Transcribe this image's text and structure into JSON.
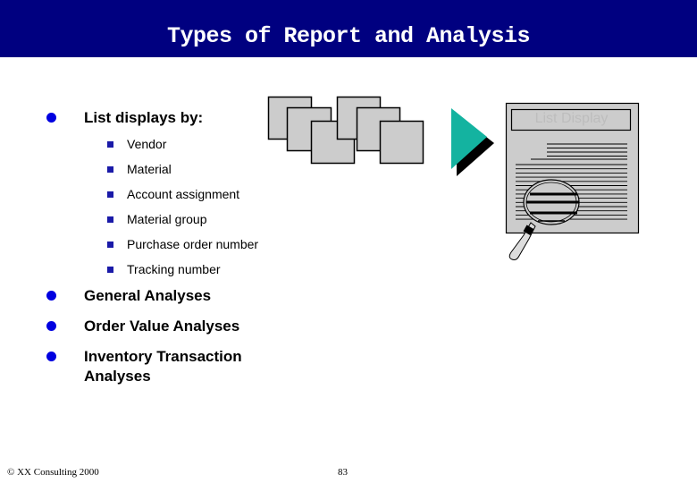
{
  "header": {
    "title": "Types of Report and Analysis"
  },
  "bullets": {
    "list_displays": {
      "label": "List displays by:",
      "items": [
        "Vendor",
        "Material",
        "Account assignment",
        "Material group",
        "Purchase order number",
        "Tracking number"
      ]
    },
    "general": "General Analyses",
    "order_value": "Order Value Analyses",
    "inventory_line1": "Inventory Transaction",
    "inventory_line2": "Analyses"
  },
  "illustration": {
    "document_label": "List Display",
    "icons": [
      "document-stack-icon",
      "arrow-right-icon",
      "list-document-icon",
      "magnifier-icon"
    ],
    "colors": {
      "arrow": "#14b3a0",
      "sheet": "#cccccc",
      "bullet_major": "#0000e0",
      "bullet_minor": "#1a1aa8",
      "title_bar": "#000080"
    }
  },
  "footer": {
    "copyright": "© XX Consulting 2000",
    "page_number": "83"
  }
}
